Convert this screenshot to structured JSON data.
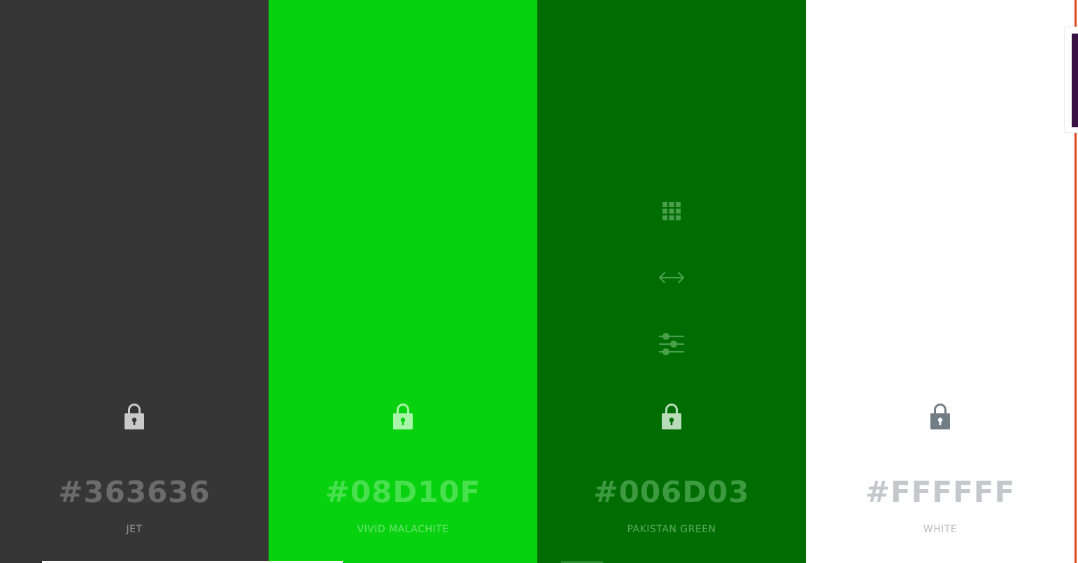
{
  "swatches": [
    {
      "id": "jet",
      "hex": "#363636",
      "name": "JET",
      "bg": "#363636",
      "text_color": "#6b6b6b",
      "name_color": "#9a9a9a",
      "lock_color": "#c9c9c9",
      "lock_hole_color": "#363636",
      "show_tools": false
    },
    {
      "id": "vivid-malachite",
      "hex": "#08D10F",
      "name": "VIVID MALACHITE",
      "bg": "#08d10f",
      "text_color": "#49e04e",
      "name_color": "#6fe673",
      "lock_color": "#a8f5aa",
      "lock_hole_color": "#08d10f",
      "show_tools": false
    },
    {
      "id": "pakistan-green",
      "hex": "#006D03",
      "name": "PAKISTAN GREEN",
      "bg": "#006d03",
      "text_color": "#3d9a40",
      "name_color": "#5aaa5c",
      "lock_color": "#b8dcb9",
      "lock_hole_color": "#006d03",
      "show_tools": true,
      "tools_color": "#4a9f4c"
    },
    {
      "id": "white",
      "hex": "#FFFFFF",
      "name": "WHITE",
      "bg": "#ffffff",
      "text_color": "#c4c7cc",
      "name_color": "#b9bcc2",
      "lock_color": "#737d86",
      "lock_hole_color": "#ffffff",
      "show_tools": false
    }
  ],
  "tools": [
    {
      "icon": "grid-icon"
    },
    {
      "icon": "horizontal-arrows-icon"
    },
    {
      "icon": "sliders-icon"
    }
  ],
  "accent_color": "#d9491b",
  "side_panel_color": "#3b1342"
}
